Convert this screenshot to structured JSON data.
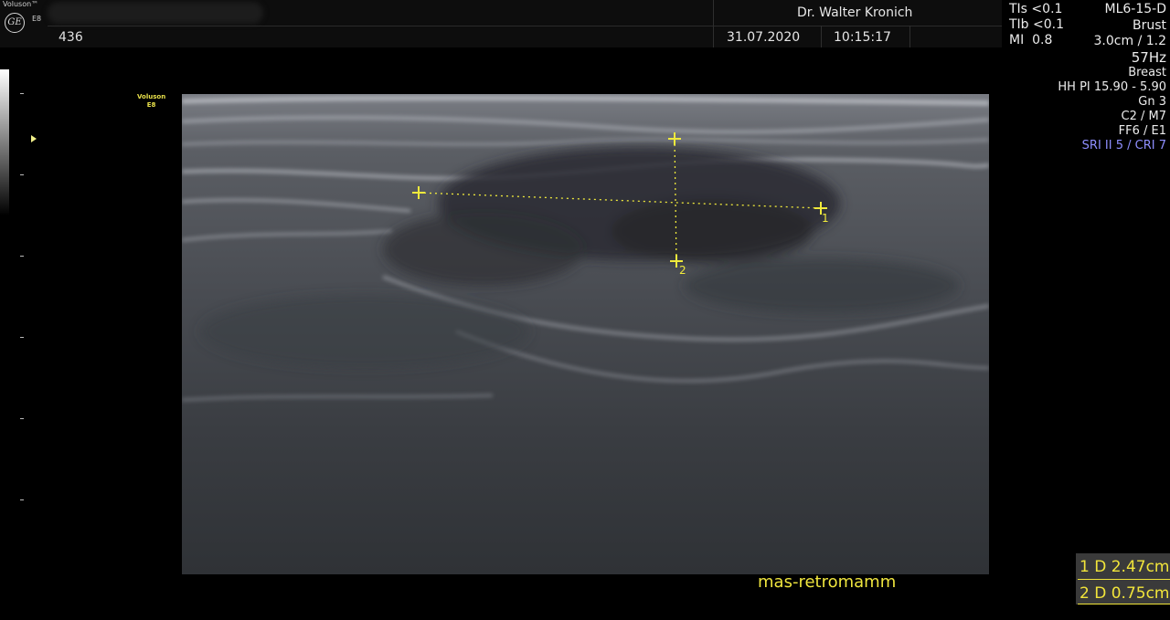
{
  "header": {
    "brand": "Voluson™",
    "model_small": "E8",
    "logo_text": "GE",
    "patient_id": "436",
    "doctor": "Dr. Walter Kronich",
    "date": "31.07.2020",
    "time": "10:15:17"
  },
  "safety": {
    "tis": "TIs <0.1",
    "tib": "TIb <0.1",
    "mi": "MI  0.8"
  },
  "probe": {
    "name": "ML6-15-D",
    "preset": "Brust",
    "depth": "3.0cm / 1.2",
    "frame_rate": "57Hz"
  },
  "params": {
    "application": "Breast",
    "harmonic": "HH PI 15.90 - 5.90",
    "gain": "Gn  3",
    "map": "C2 / M7",
    "filter": "FF6 / E1",
    "sri": "SRI II 5 / CRI 7"
  },
  "mini_label": {
    "line1": "Voluson",
    "line2": "E8"
  },
  "image": {
    "caliper1_label": "1",
    "caliper2_label": "2",
    "caption": "mas-retromamm"
  },
  "measurements": [
    {
      "label": "1 D",
      "value": "2.47cm"
    },
    {
      "label": "2 D",
      "value": "0.75cm"
    }
  ],
  "colors": {
    "caliper": "#f0ea3c",
    "sri": "#8f8fff",
    "measure_box": "#3a3a3a"
  }
}
